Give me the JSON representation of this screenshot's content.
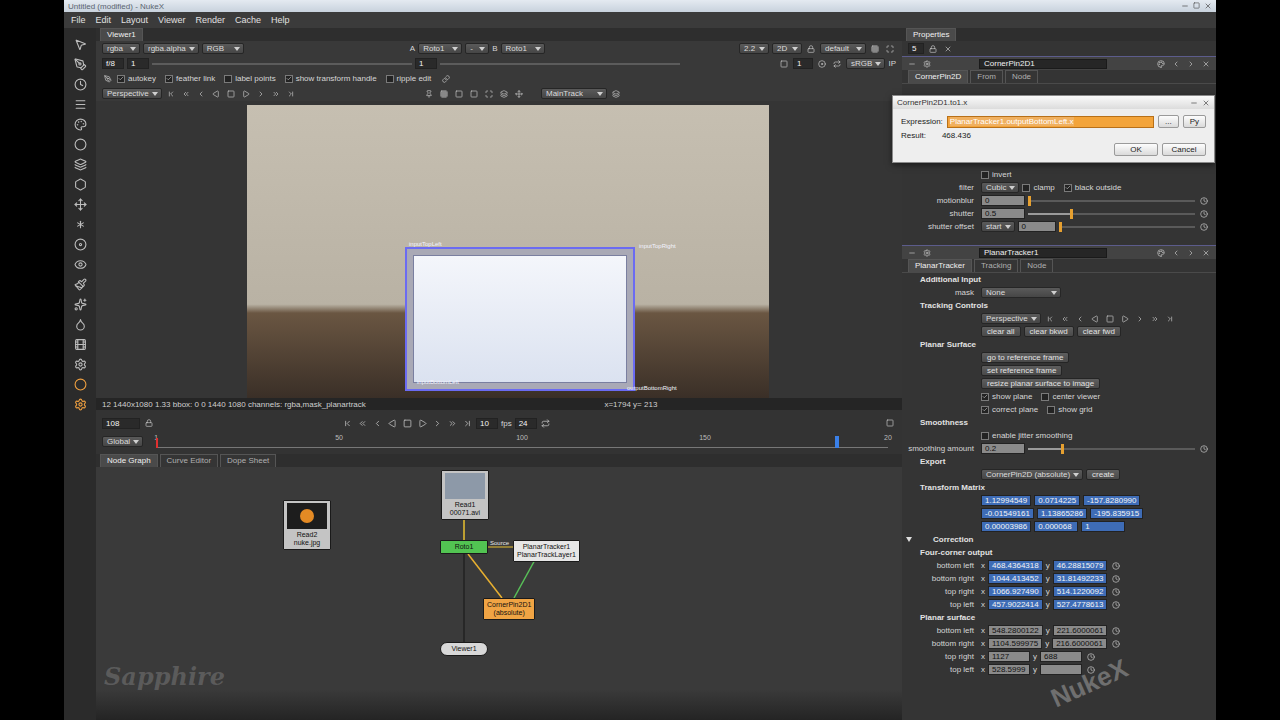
{
  "window": {
    "title": "Untitled (modified) - NukeX"
  },
  "menu": [
    "File",
    "Edit",
    "Layout",
    "Viewer",
    "Render",
    "Cache",
    "Help"
  ],
  "viewer": {
    "tab": "Viewer1",
    "channels": [
      "rgba",
      "rgba.alpha",
      "RGB"
    ],
    "compare": {
      "a_label": "A",
      "a_input": "Roto1",
      "operation": "-",
      "b_label": "B",
      "b_input": "Roto1"
    },
    "display": [
      "2.2",
      "2D",
      "default"
    ],
    "fstop": "f/8",
    "gain": "1",
    "gamma": "1",
    "proxy": "1",
    "lut": "sRGB",
    "input_process": "IP",
    "roto_options": [
      {
        "label": "autokey",
        "checked": true
      },
      {
        "label": "feather link",
        "checked": true
      },
      {
        "label": "label points",
        "checked": false
      },
      {
        "label": "show transform handle",
        "checked": true
      },
      {
        "label": "ripple edit",
        "checked": false
      }
    ],
    "track_mode": "Perspective",
    "track_layer": "MainTrack",
    "corner_labels": [
      "inputTopLeft",
      "inputTopRight",
      "inputBottomLeft",
      "outputBottomRight"
    ],
    "info": "12 1440x1080 1.33 bbox: 0 0 1440 1080 channels: rgba,mask_planartrack",
    "cursor": "x=1794 y= 213"
  },
  "timeline": {
    "frame": "108",
    "range": "Global",
    "current": "10",
    "fps_label": "fps",
    "fps": "24",
    "ticks": [
      "1",
      "50",
      "100",
      "150",
      "20"
    ],
    "level": 0.93
  },
  "node_graph": {
    "tabs": [
      {
        "label": "Node Graph",
        "selected": true
      },
      {
        "label": "Curve Editor",
        "selected": false
      },
      {
        "label": "Dope Sheet",
        "selected": false
      }
    ],
    "nodes": [
      {
        "name": "Read2",
        "label": "nuke.jpg",
        "kind": "read",
        "color": "#c4c4c4"
      },
      {
        "name": "Read1",
        "label": "00071.avi",
        "kind": "read",
        "color": "#c4c4c4"
      },
      {
        "name": "Roto1",
        "kind": "op",
        "color": "#52c452"
      },
      {
        "name": "PlanarTracker1",
        "label": "PlanarTrackLayer1",
        "kind": "op",
        "color": "#e6e6e6"
      },
      {
        "name": "CornerPin2D1",
        "label": "(absolute)",
        "kind": "op",
        "color": "#f0a444"
      },
      {
        "name": "Viewer1",
        "kind": "viewer",
        "color": "#d8d8d8"
      }
    ],
    "edge_label": "Source"
  },
  "properties": {
    "title": "Properties",
    "max_panels": "5",
    "cornerpin": {
      "name": "CornerPin2D1",
      "tabs": [
        {
          "label": "CornerPin2D",
          "selected": true
        },
        {
          "label": "From",
          "selected": false
        },
        {
          "label": "Node",
          "selected": false
        }
      ],
      "rows": [
        {
          "kind": "check",
          "label": "invert",
          "checked": false
        },
        {
          "kind": "filter",
          "label": "filter",
          "value": "Cubic",
          "checks": [
            {
              "label": "clamp",
              "checked": false
            },
            {
              "label": "black outside",
              "checked": true
            }
          ]
        },
        {
          "kind": "slider",
          "label": "motionblur",
          "value": "0",
          "level": 0
        },
        {
          "kind": "slider",
          "label": "shutter",
          "value": "0.5",
          "level": 0.25
        },
        {
          "kind": "dropslider",
          "label": "shutter offset",
          "option": "start",
          "value": "0",
          "level": 0
        }
      ]
    },
    "dialog": {
      "title": "CornerPin2D1.to1.x",
      "expression_label": "Expression:",
      "expression": "PlanarTracker1.outputBottomLeft.x",
      "browse": "...",
      "py": "Py",
      "result_label": "Result:",
      "result": "468.436",
      "ok": "OK",
      "cancel": "Cancel"
    },
    "planartracker": {
      "name": "PlanarTracker1",
      "x_label": "x",
      "y_label": "y",
      "tabs": [
        {
          "label": "PlanarTracker",
          "selected": true
        },
        {
          "label": "Tracking",
          "selected": false
        },
        {
          "label": "Node",
          "selected": false
        }
      ],
      "rows": [
        {
          "kind": "heading",
          "label": "Additional Input"
        },
        {
          "kind": "dropdown",
          "label": "mask",
          "value": "None"
        },
        {
          "kind": "heading",
          "label": "Tracking Controls"
        },
        {
          "kind": "trackbar",
          "value": "Perspective"
        },
        {
          "kind": "buttons",
          "buttons": [
            "clear all",
            "clear bkwd",
            "clear fwd"
          ]
        },
        {
          "kind": "heading",
          "label": "Planar Surface"
        },
        {
          "kind": "buttons",
          "buttons": [
            "go to reference frame"
          ]
        },
        {
          "kind": "buttons",
          "buttons": [
            "set reference frame"
          ]
        },
        {
          "kind": "buttons",
          "buttons": [
            "resize planar surface to image"
          ]
        },
        {
          "kind": "checks",
          "checks": [
            {
              "label": "show plane",
              "checked": true
            },
            {
              "label": "center viewer",
              "checked": false
            }
          ]
        },
        {
          "kind": "checks",
          "checks": [
            {
              "label": "correct plane",
              "checked": true
            },
            {
              "label": "show grid",
              "checked": false
            }
          ]
        },
        {
          "kind": "heading",
          "label": "Smoothness"
        },
        {
          "kind": "checks",
          "checks": [
            {
              "label": "enable jitter smoothing",
              "checked": false
            }
          ]
        },
        {
          "kind": "slider",
          "label": "smoothing amount",
          "value": "0.2",
          "level": 0.2
        },
        {
          "kind": "heading",
          "label": "Export"
        },
        {
          "kind": "export",
          "value": "CornerPin2D (absolute)",
          "button": "create"
        },
        {
          "kind": "heading",
          "label": "Transform Matrix"
        },
        {
          "kind": "matrix",
          "cells": [
            "1.12994549",
            "0.0714225",
            "-157.8280990"
          ]
        },
        {
          "kind": "matrix",
          "cells": [
            "-0.01549161",
            "1.13865286",
            "-195.835915"
          ]
        },
        {
          "kind": "matrix",
          "cells": [
            "0.00003986",
            "0.000068",
            "1"
          ]
        },
        {
          "kind": "toggle",
          "label": "Correction",
          "expanded": true
        },
        {
          "kind": "heading",
          "label": "Four-corner output"
        },
        {
          "kind": "xy",
          "label": "bottom left",
          "x": "468.4364318",
          "y": "46.28815079",
          "animated": true
        },
        {
          "kind": "xy",
          "label": "bottom right",
          "x": "1044.413452",
          "y": "31.81492233",
          "animated": true
        },
        {
          "kind": "xy",
          "label": "top right",
          "x": "1066.927490",
          "y": "514.1220092",
          "animated": true
        },
        {
          "kind": "xy",
          "label": "top left",
          "x": "457.9022414",
          "y": "527.4778613",
          "animated": true
        },
        {
          "kind": "heading",
          "label": "Planar surface"
        },
        {
          "kind": "xy",
          "label": "bottom left",
          "x": "548.2800122",
          "y": "221.6000061",
          "animated": false
        },
        {
          "kind": "xy",
          "label": "bottom right",
          "x": "1104.599975",
          "y": "216.6000061",
          "animated": false
        },
        {
          "kind": "xy",
          "label": "top right",
          "x": "1127",
          "y": "688",
          "animated": false
        },
        {
          "kind": "xy",
          "label": "top left",
          "x": "528.5999",
          "animated": false
        }
      ]
    }
  },
  "watermarks": [
    "Sapphire",
    "NukeX"
  ]
}
